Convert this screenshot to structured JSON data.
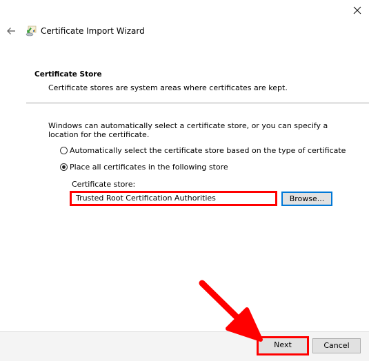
{
  "window": {
    "title": "Certificate Import Wizard",
    "back_icon": "back-arrow-icon",
    "app_icon": "certificate-import-icon",
    "close_icon": "close-icon"
  },
  "section": {
    "title": "Certificate Store",
    "subtitle": "Certificate stores are system areas where certificates are kept."
  },
  "body": {
    "description": "Windows can automatically select a certificate store, or you can specify a location for the certificate.",
    "options": [
      {
        "label": "Automatically select the certificate store based on the type of certificate",
        "selected": false
      },
      {
        "label": "Place all certificates in the following store",
        "selected": true
      }
    ],
    "store_label": "Certificate store:",
    "store_value": "Trusted Root Certification Authorities",
    "browse_label": "Browse..."
  },
  "footer": {
    "next_label": "Next",
    "cancel_label": "Cancel"
  },
  "annotations": {
    "highlight_color": "#ff0000",
    "highlighted": [
      "store-input",
      "next-button"
    ],
    "arrow_points_to": "next-button"
  }
}
